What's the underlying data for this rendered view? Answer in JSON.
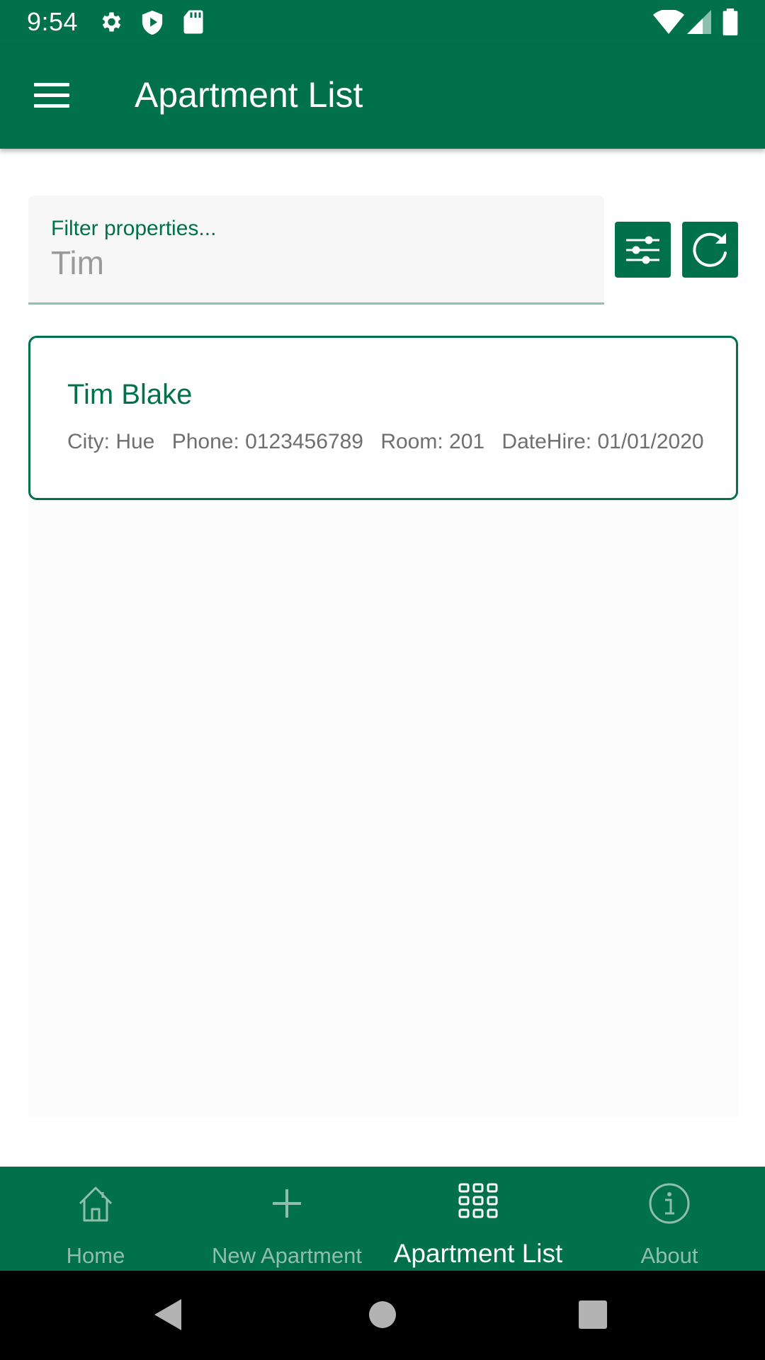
{
  "status_bar": {
    "time": "9:54",
    "icons": [
      "settings-gear-icon",
      "shield-icon",
      "sd-card-icon",
      "wifi-icon",
      "signal-icon",
      "battery-icon"
    ]
  },
  "app_bar": {
    "title": "Apartment List",
    "menu_icon": "hamburger-menu-icon"
  },
  "filter": {
    "label": "Filter properties...",
    "value": "Tim",
    "filter_button_icon": "sliders-icon",
    "refresh_button_icon": "refresh-icon"
  },
  "apartments": [
    {
      "name": "Tim Blake",
      "city": "City: Hue",
      "phone": "Phone: 0123456789",
      "room": "Room: 201",
      "date_hire": "DateHire: 01/01/2020"
    }
  ],
  "bottom_nav": {
    "items": [
      {
        "label": "Home",
        "icon": "home-icon",
        "active": false
      },
      {
        "label": "New Apartment",
        "icon": "plus-icon",
        "active": false
      },
      {
        "label": "Apartment List",
        "icon": "grid-icon",
        "active": true
      },
      {
        "label": "About",
        "icon": "info-icon",
        "active": false
      }
    ]
  },
  "colors": {
    "primary": "#00714b",
    "inactive_nav": "#8fbfac",
    "filter_underline": "#8cc3ad"
  }
}
